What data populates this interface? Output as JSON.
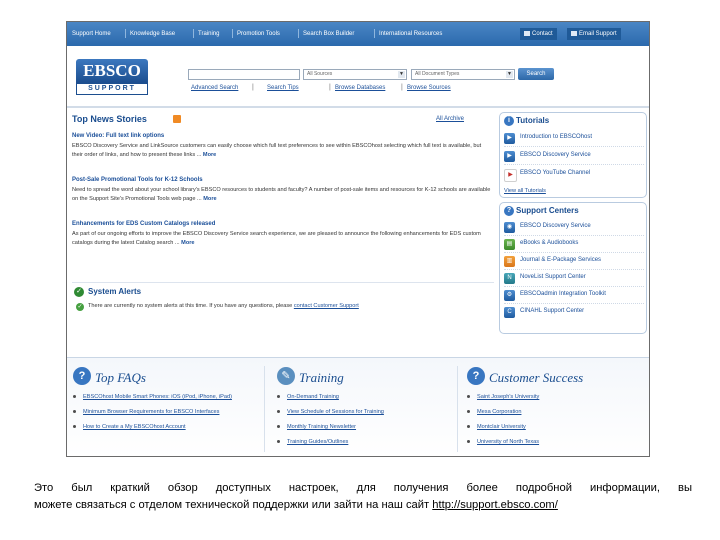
{
  "topnav": {
    "items": [
      "Support Home",
      "Knowledge Base",
      "Training",
      "Promotion Tools",
      "Search Box Builder",
      "International Resources"
    ],
    "contact_label": "Contact",
    "email_label": "Email Support"
  },
  "header": {
    "logo_top": "EBSCO",
    "logo_bottom": "SUPPORT",
    "search_value": "",
    "scope_select": "All Sources",
    "type_select": "All Document Types",
    "search_button": "Search",
    "links": [
      "Advanced Search",
      "Search Tips",
      "Browse Databases",
      "Browse Sources"
    ]
  },
  "news": {
    "title": "Top News Stories",
    "archive": "All Archive",
    "stories": [
      {
        "headline": "New Video: Full text link options",
        "body": "EBSCO Discovery Service and LinkSource customers can easily choose which full text preferences to see within EBSCOhost selecting which full text is available, but their order of links, and how to present these links ...",
        "more": "More"
      },
      {
        "headline": "Post-Sale Promotional Tools for K-12 Schools",
        "body": "Need to spread the word about your school library's EBSCO resources to students and faculty? A number of post-sale items and resources for K-12 schools are available on the Support Site's Promotional Tools web page ...",
        "more": "More"
      },
      {
        "headline": "Enhancements for EDS Custom Catalogs released",
        "body": "As part of our ongoing efforts to improve the EBSCO Discovery Service search experience, we are pleased to announce the following enhancements for EDS custom catalogs during the latest Catalog search ...",
        "more": "More"
      }
    ]
  },
  "alerts": {
    "title": "System Alerts",
    "text": "There are currently no system alerts at this time. If you have any questions, please",
    "link": "contact Customer Support"
  },
  "tutorials": {
    "title": "Tutorials",
    "items": [
      "Introduction to EBSCOhost",
      "EBSCO Discovery Service",
      "EBSCO YouTube Channel"
    ],
    "view_all": "View all Tutorials"
  },
  "support_centers": {
    "title": "Support Centers",
    "items": [
      "EBSCO Discovery Service",
      "eBooks & Audiobooks",
      "Journal & E-Package Services",
      "NoveList Support Center",
      "EBSCOadmin Integration Toolkit",
      "CINAHL Support Center"
    ]
  },
  "bottom": {
    "faqs": {
      "title": "Top FAQs",
      "items": [
        "EBSCOhost Mobile Smart Phones: iOS (iPod, iPhone, iPad)",
        "Minimum Browser Requirements for EBSCO Interfaces",
        "How to Create a My EBSCOhost Account"
      ]
    },
    "training": {
      "title": "Training",
      "items": [
        "On-Demand Training",
        "View Schedule of Sessions for Training",
        "Monthly Training Newsletter",
        "Training Guides/Outlines"
      ]
    },
    "customer_success": {
      "title": "Customer Success",
      "items": [
        "Saint Joseph's University",
        "Mesa Corporation",
        "Montclair University",
        "University of North Texas"
      ]
    }
  },
  "caption": {
    "line1": "Это был краткий обзор доступных настроек, для получения более подробной информации, вы",
    "line2": "можете связаться с отделом технической поддержки или зайти на наш сайт",
    "link": "http://support.ebsco.com/"
  },
  "colors": {
    "nav_blue": "#2b69ad",
    "link_blue": "#1b4f99",
    "heading_blue": "#1a4d8f",
    "rss_orange": "#f08a24",
    "alert_green": "#46a040"
  }
}
